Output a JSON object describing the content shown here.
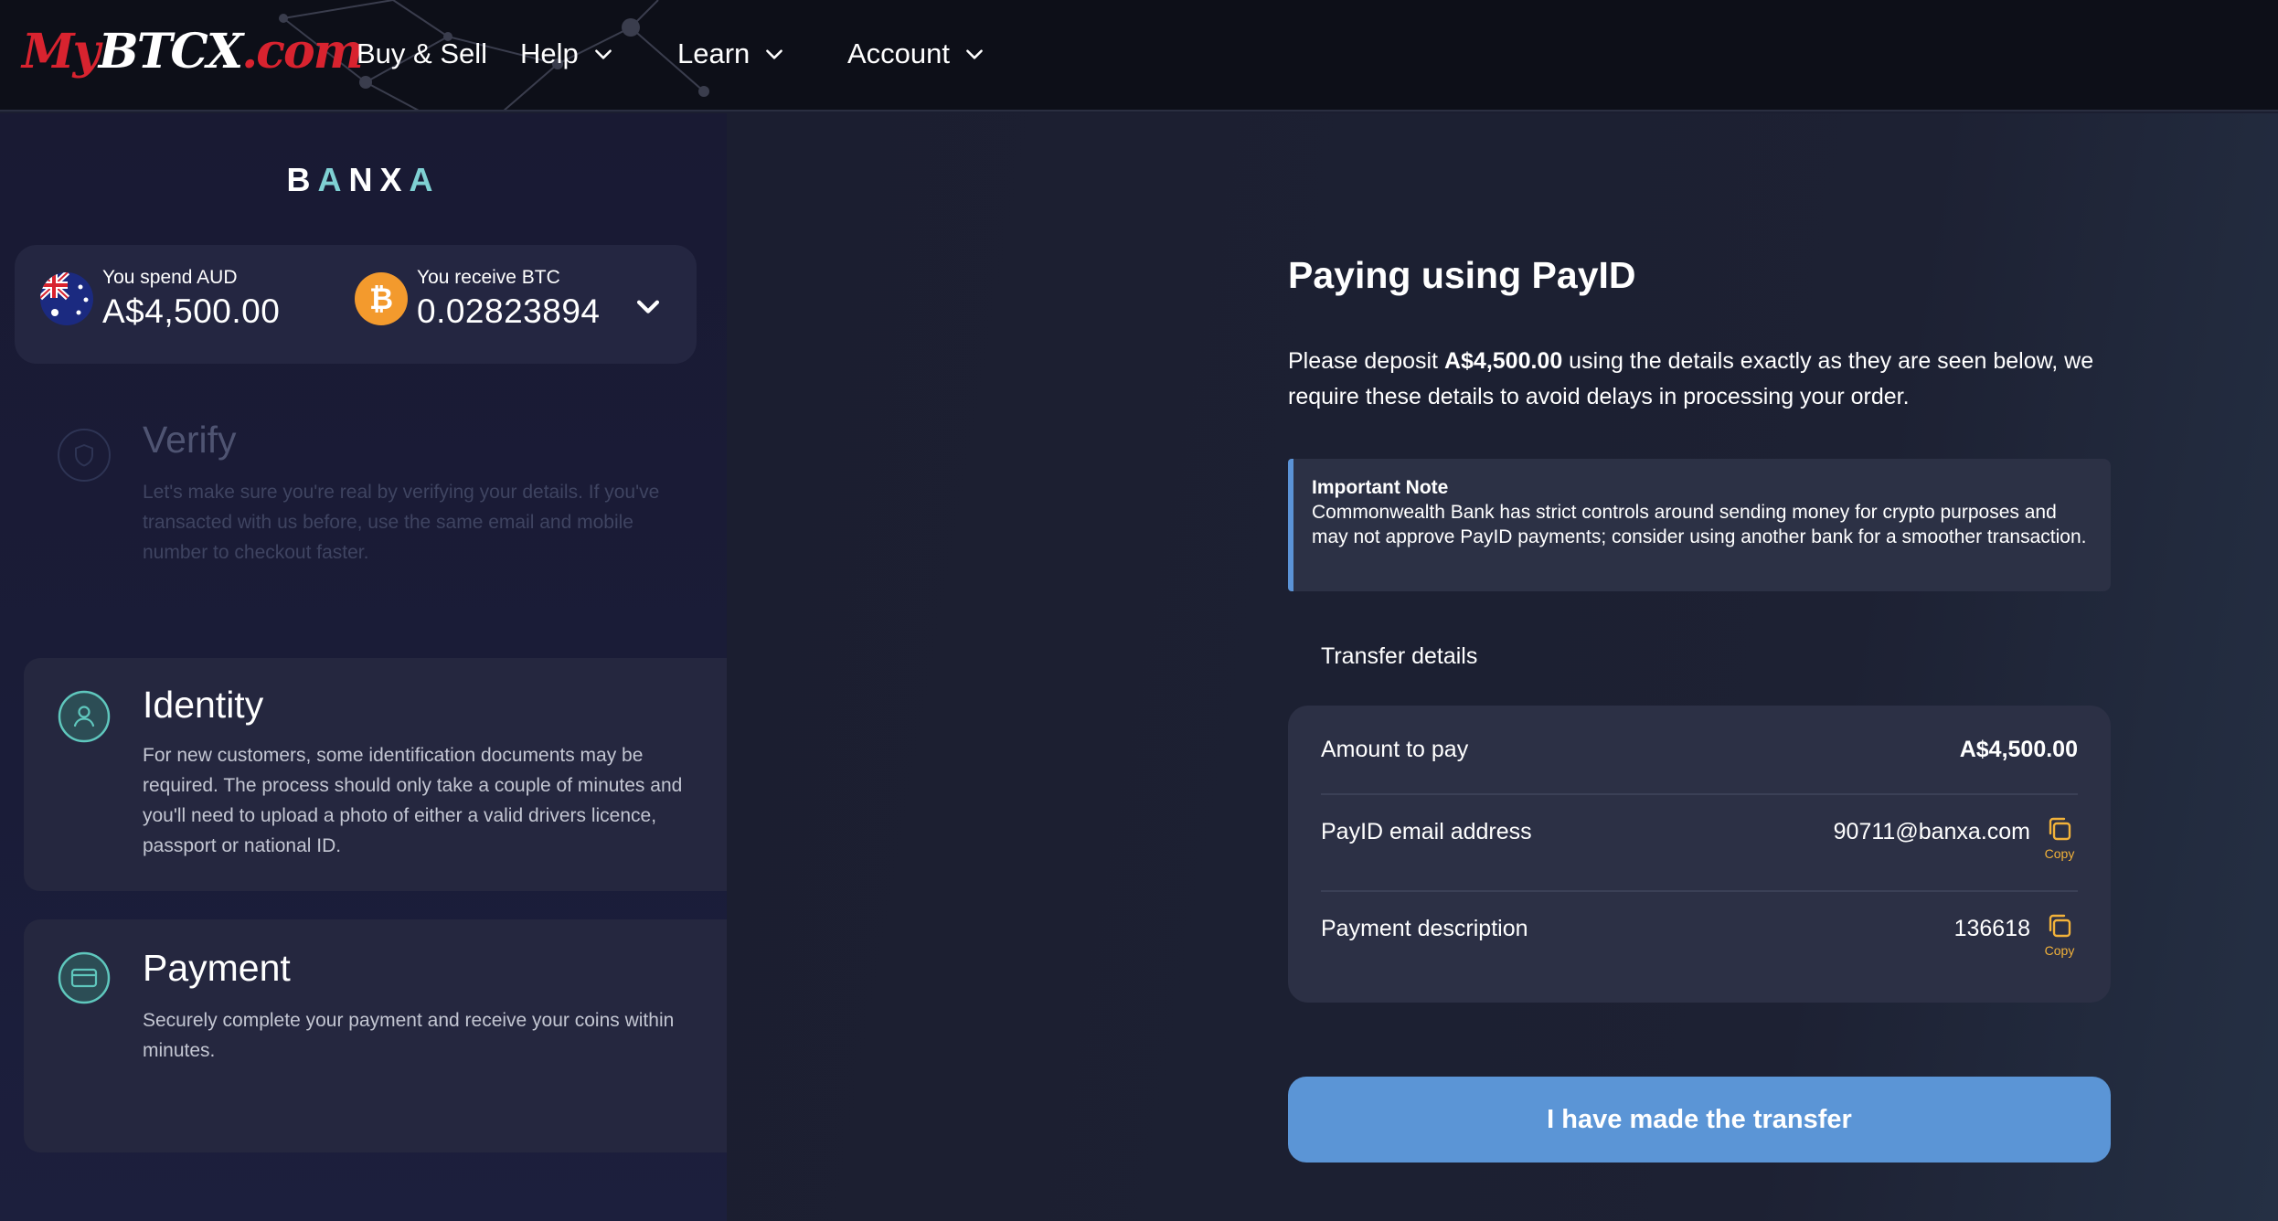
{
  "header": {
    "logo": {
      "my": "My",
      "btc": "BTCX",
      "com": ".com"
    },
    "nav": [
      {
        "label": "Buy & Sell"
      },
      {
        "label": "Help"
      },
      {
        "label": "Learn"
      },
      {
        "label": "Account"
      }
    ]
  },
  "sidebar": {
    "brand": "BANXA",
    "spend_label": "You spend AUD",
    "spend_value": "A$4,500.00",
    "receive_label": "You receive BTC",
    "receive_value": "0.02823894",
    "steps": [
      {
        "title": "Verify",
        "description": "Let's make sure you're real by verifying your details. If you've transacted with us before, use the same email and mobile number to checkout faster."
      },
      {
        "title": "Identity",
        "description": "For new customers, some identification documents may be required. The process should only take a couple of minutes and you'll need to upload a photo of either a valid drivers licence, passport or national ID."
      },
      {
        "title": "Payment",
        "description": "Securely complete your payment and receive your coins within minutes."
      }
    ]
  },
  "main": {
    "title": "Paying using PayID",
    "intro_pre": "Please deposit ",
    "intro_amount": "A$4,500.00",
    "intro_post": " using the details exactly as they are seen below, we require these details to avoid delays in processing your order.",
    "note_title": "Important Note",
    "note_body": "Commonwealth Bank has strict controls around sending money for crypto purposes and may not approve PayID payments; consider using another bank for a smoother transaction.",
    "transfer_title": "Transfer details",
    "rows": [
      {
        "label": "Amount to pay",
        "value": "A$4,500.00"
      },
      {
        "label": "PayID email address",
        "value": "90711@banxa.com",
        "copy": "Copy"
      },
      {
        "label": "Payment description",
        "value": "136618",
        "copy": "Copy"
      }
    ],
    "cta": "I have made the transfer"
  },
  "colors": {
    "accent_blue": "#5b95d6",
    "copy_gold": "#f2b23a",
    "brand_red": "#d8232f",
    "teal_icon": "#5fc7bd"
  }
}
